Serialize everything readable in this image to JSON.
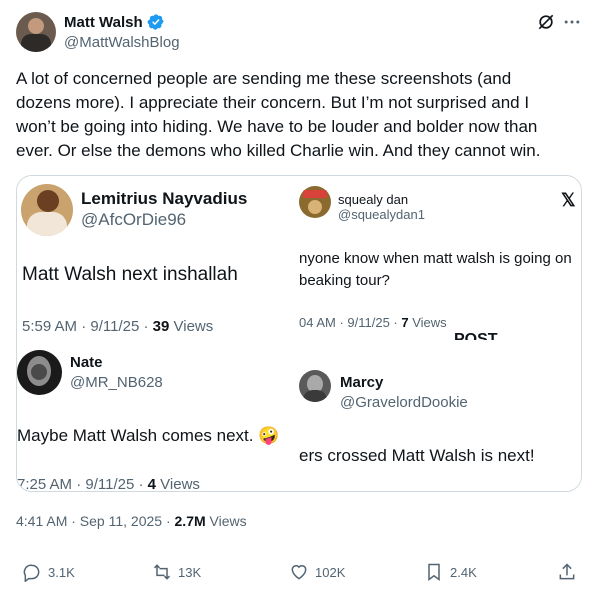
{
  "author": {
    "name": "Matt Walsh",
    "handle": "@MattWalshBlog",
    "verified_icon": "verified-badge-icon",
    "verified_color": "#1d9bf0"
  },
  "post": {
    "text": "A lot of concerned people are sending me these screenshots (and dozens more). I appreciate their concern. But I’m not surprised and I won’t be going into hiding. We have to be louder and bolder now than ever. Or else the demons who killed Charlie win. And they cannot win.",
    "time": "4:41 AM · Sep 11, 2025 · ",
    "views_count": "2.7M",
    "views_label": "Views"
  },
  "screenshots": {
    "s1": {
      "name": "Lemitrius Nayvadius",
      "handle": "@AfcOrDie96",
      "text": "Matt Walsh next inshallah",
      "meta": "5:59 AM · 9/11/25 · ",
      "views_count": "39",
      "views_label": "Views"
    },
    "s2": {
      "name": "squealy dan",
      "handle": "@squealydan1",
      "x_logo": "𝕏",
      "text_line1": "nyone know when matt walsh is going on",
      "text_line2": "beaking tour?",
      "meta": "04 AM · 9/11/25 · ",
      "views_count": "7",
      "views_label": "Views",
      "cut_text": "Post"
    },
    "s3": {
      "name": "Nate",
      "handle": "@MR_NB628",
      "text": "Maybe Matt Walsh comes next.",
      "emoji": "🤪",
      "meta": "7:25 AM · 9/11/25 · ",
      "views_count": "4",
      "views_label": "Views"
    },
    "s4": {
      "name": "Marcy",
      "handle": "@GravelordDookie",
      "text": "ers crossed Matt Walsh is next!"
    }
  },
  "actions": {
    "replies": "3.1K",
    "reposts": "13K",
    "likes": "102K",
    "bookmarks": "2.4K"
  },
  "colors": {
    "text": "#0f1419",
    "muted": "#536471",
    "border": "#cfd9de",
    "accent": "#1d9bf0"
  }
}
